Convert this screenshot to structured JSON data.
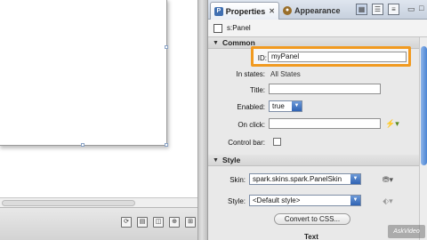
{
  "tabs": {
    "properties": "Properties",
    "appearance": "Appearance"
  },
  "component": {
    "name": "s:Panel"
  },
  "sections": {
    "common": {
      "title": "Common",
      "id_label": "ID:",
      "id_value": "myPanel",
      "in_states_label": "In states:",
      "in_states_value": "All States",
      "title_label": "Title:",
      "title_value": "",
      "enabled_label": "Enabled:",
      "enabled_value": "true",
      "onclick_label": "On click:",
      "onclick_value": "",
      "controlbar_label": "Control bar:",
      "controlbar_checked": false
    },
    "style": {
      "title": "Style",
      "skin_label": "Skin:",
      "skin_value": "spark.skins.spark.PanelSkin",
      "style_label": "Style:",
      "style_value": "<Default style>",
      "convert_button": "Convert to CSS..."
    },
    "text": {
      "title": "Text"
    }
  },
  "icons": {
    "tab_properties": "properties-icon",
    "tab_appearance": "appearance-icon",
    "view_toggle_1": "standard-view-icon",
    "view_toggle_2": "category-view-icon",
    "view_toggle_3": "alphabetical-view-icon",
    "onclick": "lightning-bolt-icon",
    "skin": "paint-bucket-icon",
    "style": "style-icon"
  },
  "colors": {
    "id_highlight": "#f19a20",
    "scroll_thumb": "#4b84d3"
  },
  "watermark": "AskVideo"
}
